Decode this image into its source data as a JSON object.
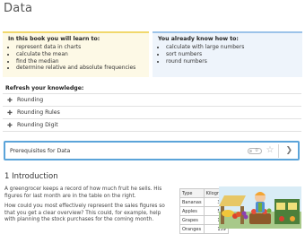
{
  "page": {
    "title": "Data"
  },
  "learn_box": {
    "heading": "In this book you will learn to:",
    "items": [
      "represent data in charts",
      "calculate the mean",
      "find the median",
      "determine relative and absolute frequencies"
    ]
  },
  "know_box": {
    "heading": "You already know how to:",
    "items": [
      "calculate with large numbers",
      "sort numbers",
      "round numbers"
    ]
  },
  "refresh": {
    "heading": "Refresh your knowledge:",
    "items": [
      "Rounding",
      "Rounding Rules",
      "Rounding Digit"
    ]
  },
  "prerequisites": {
    "label": "Prerequisites for Data",
    "toggle_value": "0"
  },
  "section": {
    "title": "1 Introduction",
    "paragraphs": [
      "A greengrocer keeps a record of how much fruit he sells. His figures for last month are in the table on the right.",
      "How could you most effectively represent the sales figures so that you get a clear overview? This could, for example, help with planning the stock purchases for the coming month."
    ]
  },
  "fruit_table": {
    "headers": [
      "Type",
      "Kilogram"
    ],
    "rows": [
      [
        "Bananas",
        "323"
      ],
      [
        "Apples",
        "532"
      ],
      [
        "Grapes",
        "182"
      ],
      [
        "Oranges",
        "159"
      ]
    ]
  },
  "colors": {
    "accent_yellow": "#f1d86c",
    "accent_blue": "#9cc3e9",
    "focus_blue": "#5ba4d9"
  },
  "icons": [
    "plus-icon",
    "star-icon",
    "chevron-right-icon"
  ]
}
